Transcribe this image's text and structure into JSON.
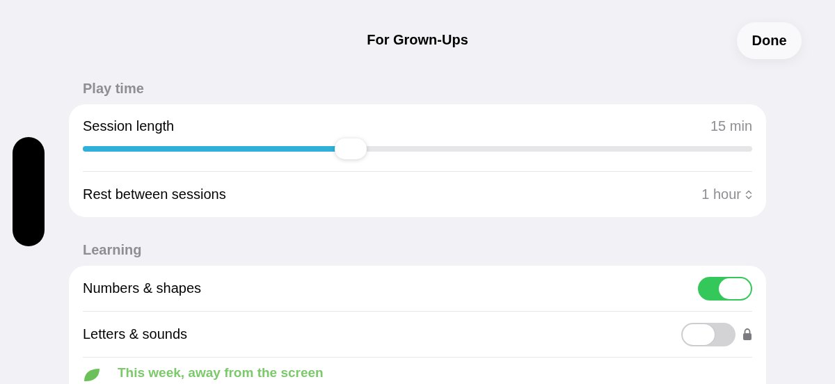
{
  "header": {
    "title": "For Grown-Ups",
    "done_button": "Done"
  },
  "sections": [
    {
      "title": "Play time",
      "rows": [
        {
          "kind": "slider",
          "label": "Session length",
          "value": "15 min",
          "level": 0.4
        },
        {
          "kind": "picker",
          "label": "Rest between sessions",
          "value": "1 hour"
        }
      ]
    },
    {
      "title": "Learning",
      "rows": [
        {
          "kind": "toggle",
          "label": "Numbers & shapes",
          "on": true,
          "locked": false
        },
        {
          "kind": "toggle",
          "label": "Letters & sounds",
          "on": false,
          "locked": true
        },
        {
          "kind": "note",
          "label": "This week, away from the screen"
        }
      ]
    }
  ]
}
